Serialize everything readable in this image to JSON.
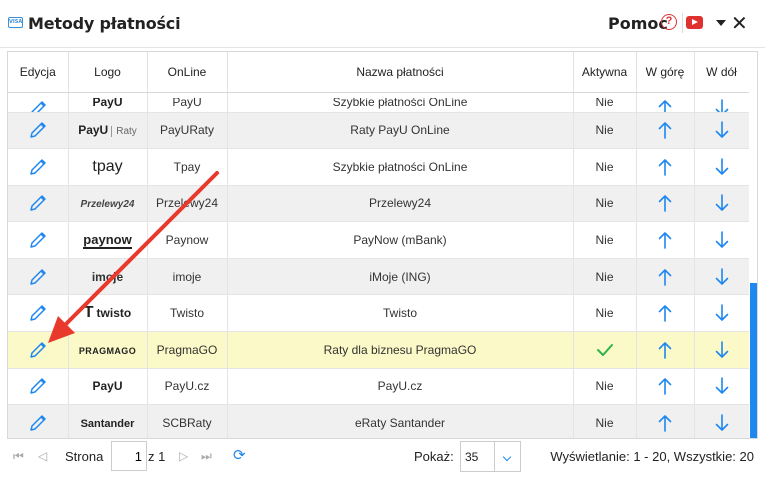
{
  "window": {
    "title": "Metody płatności",
    "help_label": "Pomoc",
    "colors": {
      "accent": "#1e87f0",
      "highlight_row": "#fbf9c7",
      "help_red": "#e03434",
      "active_check": "#2db34a"
    }
  },
  "table": {
    "columns": [
      "Edycja",
      "Logo",
      "OnLine",
      "Nazwa płatności",
      "Aktywna",
      "W górę",
      "W dół"
    ],
    "rows": [
      {
        "logo": "PayU",
        "online": "PayU",
        "name": "Szybkie płatności OnLine",
        "active": "Nie"
      },
      {
        "logo": "PayU | Raty",
        "online": "PayURaty",
        "name": "Raty PayU OnLine",
        "active": "Nie"
      },
      {
        "logo": "tpay",
        "online": "Tpay",
        "name": "Szybkie płatności OnLine",
        "active": "Nie"
      },
      {
        "logo": "Przelewy24",
        "online": "Przelewy24",
        "name": "Przelewy24",
        "active": "Nie"
      },
      {
        "logo": "paynow",
        "online": "Paynow",
        "name": "PayNow (mBank)",
        "active": "Nie"
      },
      {
        "logo": "imoje",
        "online": "imoje",
        "name": "iMoje (ING)",
        "active": "Nie"
      },
      {
        "logo": "twisto",
        "online": "Twisto",
        "name": "Twisto",
        "active": "Nie"
      },
      {
        "logo": "PRAGMAGO",
        "online": "PragmaGO",
        "name": "Raty dla biznesu PragmaGO",
        "active": ""
      },
      {
        "logo": "PayU",
        "online": "PayU.cz",
        "name": "PayU.cz",
        "active": "Nie"
      },
      {
        "logo": "Santander",
        "online": "SCBRaty",
        "name": "eRaty Santander",
        "active": "Nie"
      }
    ]
  },
  "pager": {
    "page_label": "Strona",
    "page_value": "1",
    "of_label": "z 1",
    "show_label": "Pokaż:",
    "page_size": "35",
    "info": "Wyświetlanie: 1 - 20, Wszystkie: 20"
  }
}
